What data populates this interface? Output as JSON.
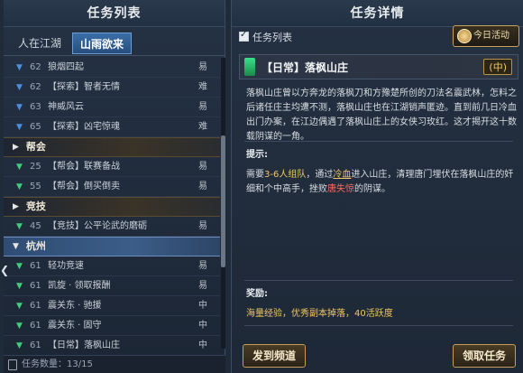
{
  "left_panel": {
    "title": "任务列表",
    "tabs": [
      {
        "label": "人在江湖"
      },
      {
        "label": "山雨欲来"
      }
    ],
    "rows": [
      {
        "kind": "quest",
        "arrow": "blue",
        "level": "62",
        "name": "狼烟四起",
        "difficulty": "易"
      },
      {
        "kind": "quest",
        "arrow": "blue",
        "level": "62",
        "name": "【探索】智者无情",
        "difficulty": "难"
      },
      {
        "kind": "quest",
        "arrow": "blue",
        "level": "63",
        "name": "神威风云",
        "difficulty": "易"
      },
      {
        "kind": "quest",
        "arrow": "blue",
        "level": "65",
        "name": "【探索】凶宅惊魂",
        "difficulty": "难"
      },
      {
        "kind": "category",
        "name": "帮会",
        "open": false
      },
      {
        "kind": "quest",
        "arrow": "green",
        "level": "25",
        "name": "【帮会】联赛备战",
        "difficulty": "易"
      },
      {
        "kind": "quest",
        "arrow": "green",
        "level": "55",
        "name": "【帮会】倒买倒卖",
        "difficulty": "易"
      },
      {
        "kind": "category",
        "name": "竞技",
        "open": false
      },
      {
        "kind": "quest",
        "arrow": "green",
        "level": "45",
        "name": "【竞技】公平论武的磨砺",
        "difficulty": "易"
      },
      {
        "kind": "category",
        "name": "杭州",
        "open": true
      },
      {
        "kind": "quest",
        "arrow": "green",
        "level": "61",
        "name": "轻功竞速",
        "difficulty": "易"
      },
      {
        "kind": "quest",
        "arrow": "green",
        "level": "61",
        "name": "凯旋 · 领取报酬",
        "difficulty": "易"
      },
      {
        "kind": "quest",
        "arrow": "green",
        "level": "61",
        "name": "震关东 · 驰援",
        "difficulty": "中"
      },
      {
        "kind": "quest",
        "arrow": "green",
        "level": "61",
        "name": "震关东 · 固守",
        "difficulty": "中"
      },
      {
        "kind": "quest",
        "arrow": "green",
        "level": "61",
        "name": "【日常】落枫山庄",
        "difficulty": "中"
      }
    ],
    "count_text": "任务数量：13/15"
  },
  "right_panel": {
    "title": "任务详情",
    "checkbox_label": "任务列表",
    "today_button": "今日活动",
    "quest_name": "【日常】落枫山庄",
    "quest_rank": "中",
    "description": "落枫山庄曾以方奔龙的落枫刀和方豫楚所创的刀法名震武林，怎料之后诸任庄主均遭不测，落枫山庄也在江湖销声匿迹。直到前几日冷血出门办案，在江边偶遇了落枫山庄上的女侠习玫红。这才揭开这十数载阴谋的一角。",
    "hint_label": "提示:",
    "hint": {
      "p1": "需要",
      "team": "3-6人组队",
      "p2": "，通过",
      "npc": "冷血",
      "p3": "进入山庄，清理唐门埋伏在落枫山庄的奸细和个中高手，挫败",
      "boss": "唐失惊",
      "p4": "的阴谋。"
    },
    "reward_label": "奖励:",
    "reward_text": "海量经验，优秀副本掉落，40活跃度",
    "btn_channel": "发到频道",
    "btn_accept": "领取任务"
  },
  "colors": {
    "accent_gold": "#f0c665",
    "warning_red": "#ff6a5a",
    "tab_blue": "#3a6ea8",
    "arrow_green": "#3fce7a",
    "arrow_blue": "#4b8fe2"
  }
}
